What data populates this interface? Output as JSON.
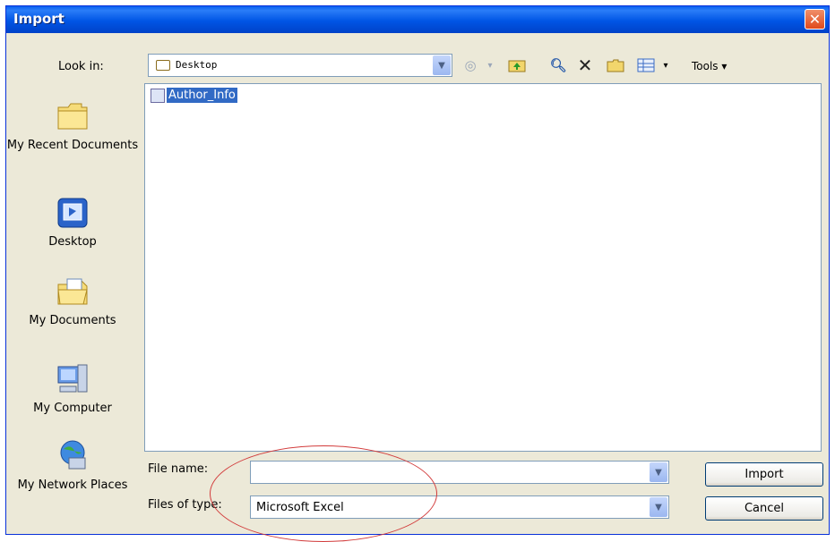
{
  "window": {
    "title": "Import"
  },
  "lookin": {
    "label": "Look in:",
    "value": "Desktop"
  },
  "toolbar": {
    "tools_label": "Tools ▾"
  },
  "places": [
    {
      "label": "My Recent Documents"
    },
    {
      "label": "Desktop"
    },
    {
      "label": "My Documents"
    },
    {
      "label": "My Computer"
    },
    {
      "label": "My Network Places"
    }
  ],
  "files": [
    {
      "name": "Author_Info",
      "selected": true
    }
  ],
  "filename": {
    "label": "File name:",
    "value": ""
  },
  "filetype": {
    "label": "Files of type:",
    "value": "Microsoft Excel"
  },
  "buttons": {
    "import": "Import",
    "cancel": "Cancel"
  },
  "colors": {
    "titlebar": "#0055e5",
    "selection": "#316ac5",
    "annotation": "#d23b3b"
  }
}
